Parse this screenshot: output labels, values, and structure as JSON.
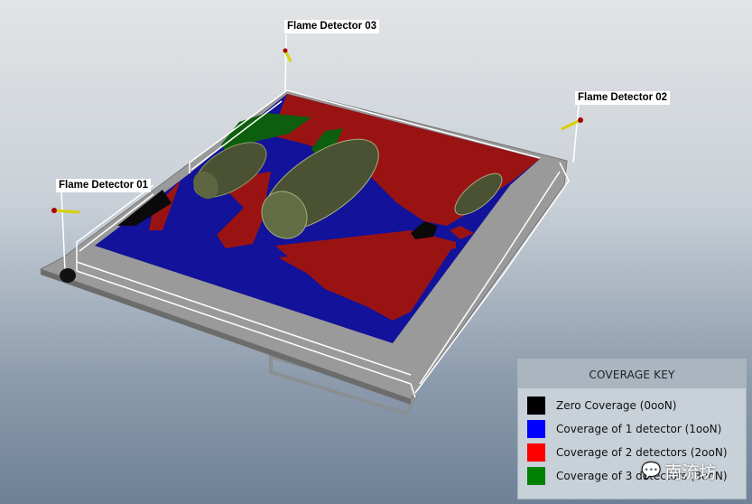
{
  "detectors": [
    {
      "label": "Flame Detector 01"
    },
    {
      "label": "Flame Detector 02"
    },
    {
      "label": "Flame Detector 03"
    }
  ],
  "legend": {
    "title": "COVERAGE KEY",
    "items": [
      {
        "label": "Zero Coverage (0ooN)",
        "color": "#000000"
      },
      {
        "label": "Coverage of 1 detector (1ooN)",
        "color": "#0000ff"
      },
      {
        "label": "Coverage of 2 detectors (2ooN)",
        "color": "#ff0000"
      },
      {
        "label": "Coverage of 3 detectors (3ooN)",
        "color": "#008000"
      }
    ]
  },
  "watermark": {
    "text": "南流坊"
  }
}
